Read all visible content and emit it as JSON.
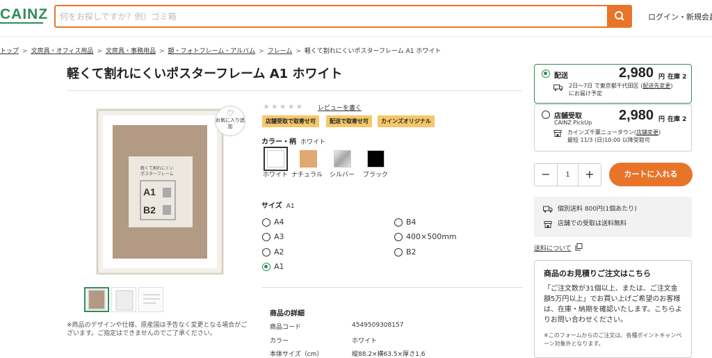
{
  "header": {
    "logo": "CAINZ",
    "search_placeholder": "何をお探しですか？例）ゴミ箱",
    "login": "ログイン・新規会員"
  },
  "breadcrumb": [
    "トップ",
    "文房具・オフィス用品",
    "文房具・事務用品",
    "額・フォトフレーム・アルバム",
    "フレーム",
    "軽くて割れにくいポスターフレーム A1 ホワイト"
  ],
  "product": {
    "title": "軽くて割れにくいポスターフレーム A1 ホワイト",
    "favorite": "お気に入り追加",
    "image_text": {
      "line1": "軽くて割れにくい",
      "line2": "ポスターフレーム",
      "size1": "A1",
      "size2": "B2"
    },
    "note": "※商品のデザインや仕様、原産国は予告なく変更となる場合がございます。ご指定はできませんのでご了承ください。",
    "review_link": "レビューを書く",
    "badges": [
      "店舗受取で取寄せ可",
      "配送で取寄せ可",
      "カインズオリジナル"
    ],
    "color_label": "カラー・柄",
    "color_value": "ホワイト",
    "colors": [
      {
        "name": "ホワイト",
        "hex": "#ffffff"
      },
      {
        "name": "ナチュラル",
        "hex": "#e0a872"
      },
      {
        "name": "シルバー",
        "hex": "#bfbfbf"
      },
      {
        "name": "ブラック",
        "hex": "#000000"
      }
    ],
    "size_label": "サイズ",
    "size_value": "A1",
    "sizes_left": [
      "A4",
      "A3",
      "A2",
      "A1"
    ],
    "sizes_right": [
      "B4",
      "400×500mm",
      "B2"
    ],
    "details_heading": "商品の詳細",
    "details": [
      {
        "key": "商品コード",
        "value": "4549509308157"
      },
      {
        "key": "カラー",
        "value": "ホワイト"
      },
      {
        "key": "本体サイズ（cm）",
        "value": "縦88.2×横63.5×厚さ1.6"
      }
    ]
  },
  "purchase": {
    "delivery_label": "配送",
    "delivery_price": "2,980",
    "yen": "円",
    "delivery_stock": "在庫 2",
    "delivery_line1": "2日〜7日 で東京都千代田区 (",
    "delivery_change": "配送先変更",
    "delivery_line1_end": ")",
    "delivery_line2": "にお届け予定",
    "store_label": "店舗受取",
    "store_price": "2,980",
    "store_stock": "在庫 2",
    "store_sub": "CAINZ PickUp",
    "store_line1": "カインズ千葉ニュータウン(",
    "store_change": "店舗変更",
    "store_line1_end": ")",
    "store_line2": "最短 11/3 (日)10:00 以降受取可",
    "qty_minus": "−",
    "qty_value": "1",
    "qty_plus": "+",
    "cart_button": "カートに入れる",
    "ship_fee": "個別送料 800円(1個あたり)",
    "store_free": "店舗での受取は送料無料",
    "shipping_link": "送料について",
    "quote_heading": "商品のお見積りご注文はこちら",
    "quote_text": "「ご注文数が31個以上、または、ご注文金額5万円以上」でお買い上げご希望のお客様は、在庫・納期を確認いたします。こちらよりお問い合わせください。",
    "quote_note": "※このフォームからのご注文は、各種ポイントキャンペーン対象外となります。"
  },
  "colors": {
    "brand_green": "#2e8b57",
    "accent_orange": "#e8742a",
    "badge_yellow": "#f5c76a"
  }
}
